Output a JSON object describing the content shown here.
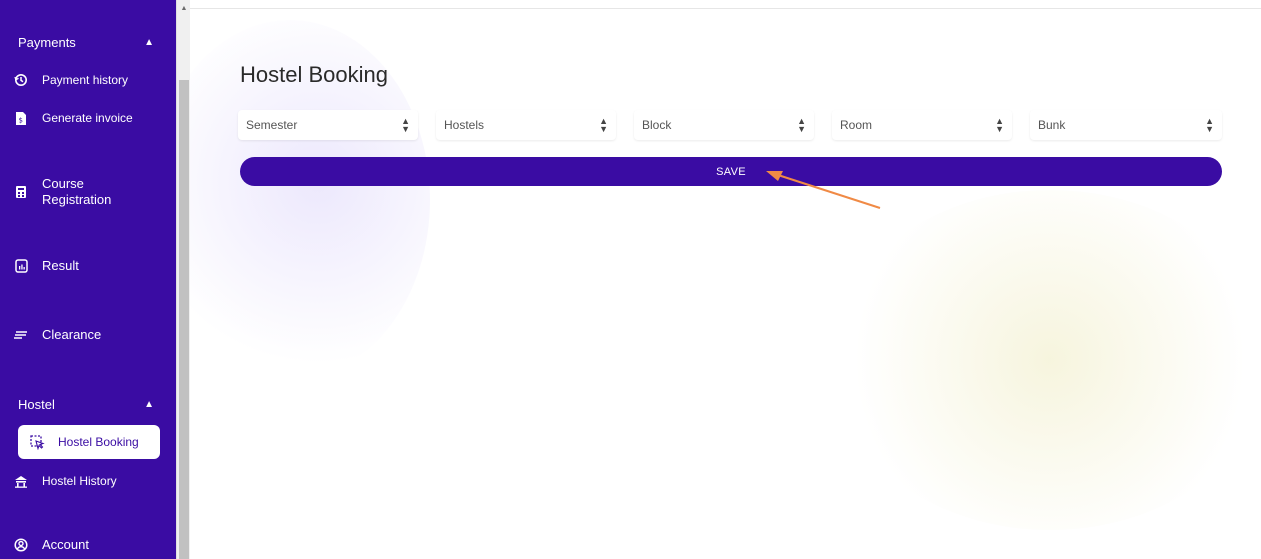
{
  "sidebar": {
    "payments_header": "Payments",
    "payment_history": "Payment history",
    "generate_invoice": "Generate invoice",
    "course_registration_line1": "Course",
    "course_registration_line2": "Registration",
    "result": "Result",
    "clearance": "Clearance",
    "hostel_header": "Hostel",
    "hostel_booking": "Hostel Booking",
    "hostel_history": "Hostel History",
    "account": "Account"
  },
  "main": {
    "title": "Hostel Booking",
    "selects": [
      {
        "label": "Semester"
      },
      {
        "label": "Hostels"
      },
      {
        "label": "Block"
      },
      {
        "label": "Room"
      },
      {
        "label": "Bunk"
      }
    ],
    "save_label": "SAVE"
  },
  "colors": {
    "primary": "#3a0ca3",
    "annotation_arrow": "#f08a45"
  }
}
